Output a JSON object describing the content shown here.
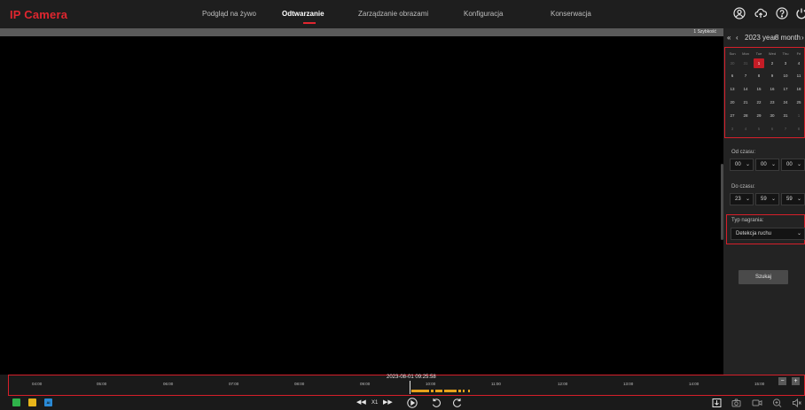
{
  "header": {
    "logo": "IP Camera",
    "nav": [
      {
        "label": "Podgląd na żywo",
        "active": false
      },
      {
        "label": "Odtwarzanie",
        "active": true
      },
      {
        "label": "Zarządzanie obrazami",
        "active": false
      },
      {
        "label": "Konfiguracja",
        "active": false
      },
      {
        "label": "Konserwacja",
        "active": false
      }
    ],
    "icons": [
      "user-icon",
      "cloud-icon",
      "help-icon",
      "power-icon"
    ]
  },
  "player": {
    "speed_label": "1 Szybkość"
  },
  "calendar": {
    "first_nav": "«",
    "prev_nav": "‹",
    "year_label": "2023 year",
    "month_label": "8 month",
    "next_nav": "›",
    "weekdays": [
      "Sun",
      "Mon",
      "Tue",
      "Wed",
      "Thu",
      "Fri"
    ],
    "weeks": [
      [
        "30",
        "31",
        "1",
        "2",
        "3",
        "4"
      ],
      [
        "6",
        "7",
        "8",
        "9",
        "10",
        "11"
      ],
      [
        "13",
        "14",
        "15",
        "16",
        "17",
        "18"
      ],
      [
        "20",
        "21",
        "22",
        "23",
        "24",
        "25"
      ],
      [
        "27",
        "28",
        "29",
        "30",
        "31",
        "1"
      ],
      [
        "3",
        "4",
        "5",
        "6",
        "7",
        "8"
      ]
    ],
    "selected_day": "1"
  },
  "search": {
    "start_label": "Od czasu:",
    "start_time": [
      "00",
      "00",
      "00"
    ],
    "end_label": "Do czasu:",
    "end_time": [
      "23",
      "59",
      "59"
    ],
    "type_label": "Typ nagrania:",
    "type_value": "Detekcja ruchu",
    "search_button": "Szukaj"
  },
  "timeline": {
    "current_time": "2023-08-01 09:25:58",
    "ticks": [
      "04:00",
      "05:00",
      "06:00",
      "07:00",
      "08:00",
      "09:00",
      "10:00",
      "11:00",
      "12:00",
      "13:00",
      "14:00",
      "15:00"
    ],
    "zoom_out": "−",
    "zoom_in": "+",
    "record_color": "#e7a21a"
  },
  "controls": {
    "chips": [
      {
        "label": "",
        "color": "#2fb34a"
      },
      {
        "label": "",
        "color": "#e7b41a"
      },
      {
        "label": "AI",
        "color": "#2a8ad6"
      }
    ],
    "rewind": "◀◀",
    "speed": "X1",
    "forward": "▶▶"
  },
  "accent_color": "#d61f2a"
}
